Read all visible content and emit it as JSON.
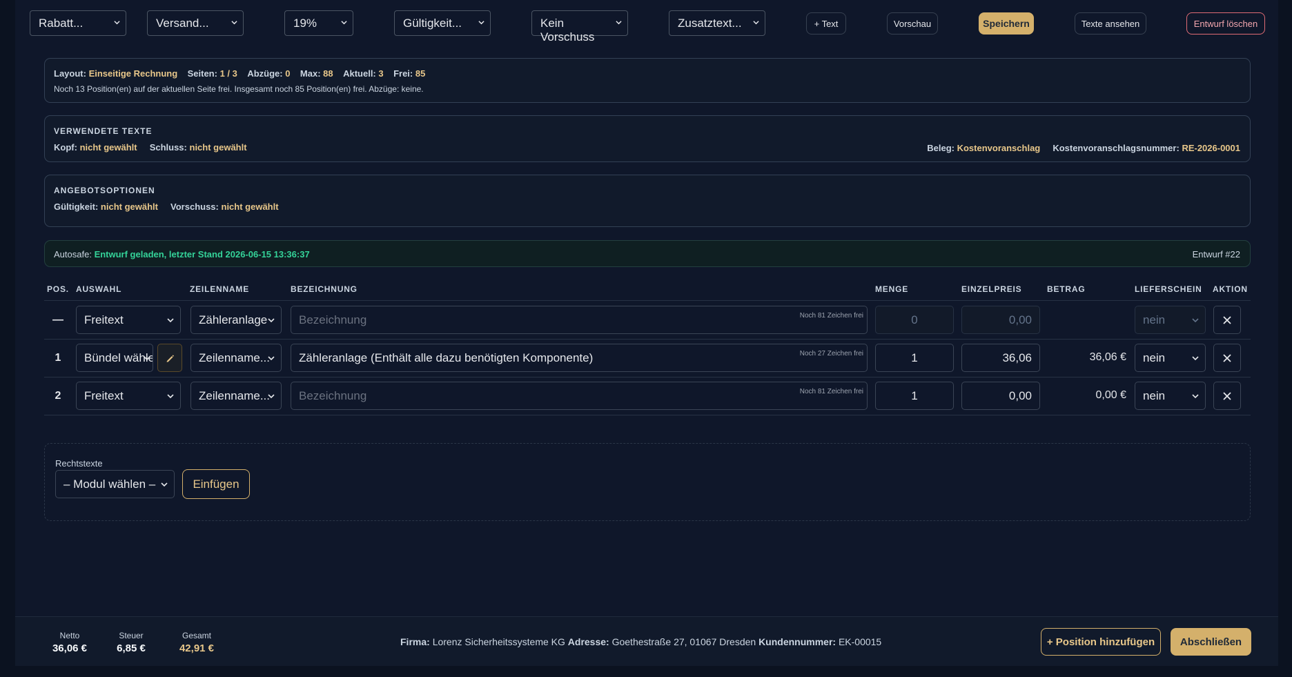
{
  "toolbar": {
    "selects": [
      "Rabatt...",
      "Versand...",
      "19%",
      "Gültigkeit...",
      "Kein Vorschuss",
      "Zusatztext..."
    ],
    "add_text": "+ Text",
    "preview": "Vorschau",
    "save": "Speichern",
    "view_texts": "Texte ansehen",
    "delete_draft": "Entwurf löschen"
  },
  "layout_panel": {
    "layout_label": "Layout:",
    "layout_value": "Einseitige Rechnung",
    "pages_label": "Seiten:",
    "pages_value": "1 / 3",
    "deductions_label": "Abzüge:",
    "deductions_value": "0",
    "max_label": "Max:",
    "max_value": "88",
    "current_label": "Aktuell:",
    "current_value": "3",
    "free_label": "Frei:",
    "free_value": "85",
    "note": "Noch 13 Position(en) auf der aktuellen Seite frei. Insgesamt noch 85 Position(en) frei. Abzüge: keine."
  },
  "texts_panel": {
    "title": "VERWENDETE TEXTE",
    "head_label": "Kopf:",
    "head_value": "nicht gewählt",
    "end_label": "Schluss:",
    "end_value": "nicht gewählt",
    "doc_label": "Beleg:",
    "doc_value": "Kostenvoranschlag",
    "number_label": "Kostenvoranschlagsnummer:",
    "number_value": "RE-2026-0001"
  },
  "offer_panel": {
    "title": "ANGEBOTSOPTIONEN",
    "validity_label": "Gültigkeit:",
    "validity_value": "nicht gewählt",
    "advance_label": "Vorschuss:",
    "advance_value": "nicht gewählt"
  },
  "autosave": {
    "label": "Autosafe:",
    "value": "Entwurf geladen, letzter Stand 2026-06-15 13:36:37",
    "draft": "Entwurf #22"
  },
  "table": {
    "headers": {
      "pos": "POS.",
      "auswahl": "AUSWAHL",
      "zeilenname": "ZEILENNAME",
      "bezeichnung": "BEZEICHNUNG",
      "menge": "MENGE",
      "einzelpreis": "EINZELPREIS",
      "betrag": "BETRAG",
      "lieferschein": "LIEFERSCHEIN",
      "aktion": "AKTION"
    },
    "rows": [
      {
        "pos": "—",
        "auswahl": "Freitext",
        "zeilenname": "Zähleranlage",
        "bezeichnung": "",
        "placeholder": "Bezeichnung",
        "hint": "Noch 81 Zeichen frei",
        "menge": "0",
        "einzelpreis": "0,00",
        "betrag": "",
        "lieferschein": "nein"
      },
      {
        "pos": "1",
        "auswahl": "Bündel wählen",
        "zeilenname": "Zeilenname...",
        "bezeichnung": "Zähleranlage (Enthält alle dazu benötigten Komponente)",
        "placeholder": "",
        "hint": "Noch 27 Zeichen frei",
        "menge": "1",
        "einzelpreis": "36,06",
        "betrag": "36,06 €",
        "lieferschein": "nein"
      },
      {
        "pos": "2",
        "auswahl": "Freitext",
        "zeilenname": "Zeilenname...",
        "bezeichnung": "",
        "placeholder": "Bezeichnung",
        "hint": "Noch 81 Zeichen frei",
        "menge": "1",
        "einzelpreis": "0,00",
        "betrag": "0,00 €",
        "lieferschein": "nein"
      }
    ]
  },
  "legal": {
    "label": "Rechtstexte",
    "select": "– Modul wählen –",
    "insert": "Einfügen"
  },
  "footer": {
    "net_label": "Netto",
    "net_value": "36,06 €",
    "tax_label": "Steuer",
    "tax_value": "6,85 €",
    "total_label": "Gesamt",
    "total_value": "42,91 €",
    "company_label": "Firma:",
    "company_value": "Lorenz Sicherheitssysteme KG",
    "address_label": "Adresse:",
    "address_value": "Goethestraße 27, 01067 Dresden",
    "customer_label": "Kundennummer:",
    "customer_value": "EK-00015",
    "add_position": "+ Position hinzufügen",
    "finish": "Abschließen"
  },
  "colors": {
    "accent": "#d4b06b",
    "gold_text": "#e8c78a",
    "green_text": "#34d399",
    "danger": "#e06c75"
  }
}
